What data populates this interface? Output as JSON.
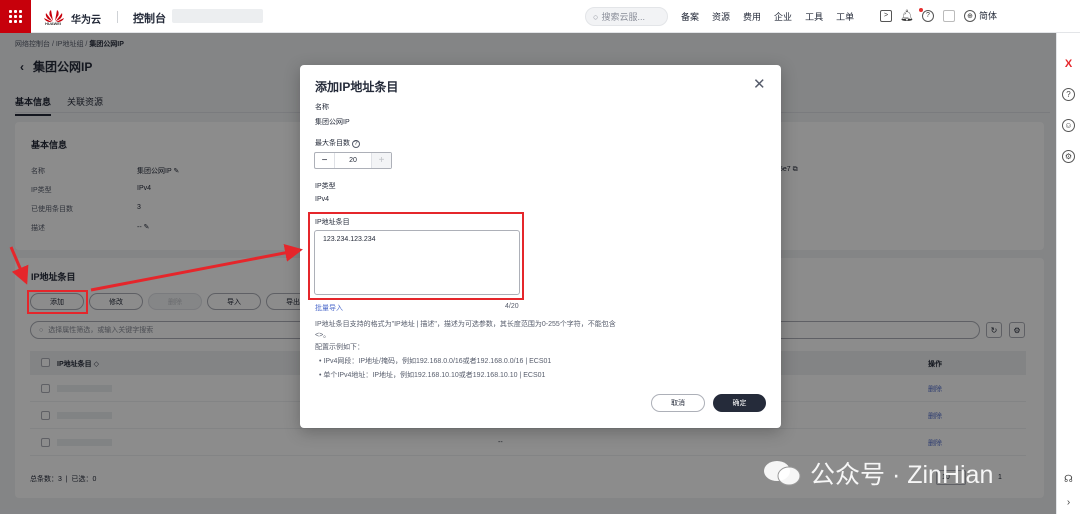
{
  "topbar": {
    "logo_text": "HUAWEI",
    "brand": "华为云",
    "console": "控制台",
    "search_placeholder": "搜索云服...",
    "nav": [
      "备案",
      "资源",
      "费用",
      "企业",
      "工具",
      "工单"
    ],
    "lang": "简体"
  },
  "breadcrumb": {
    "a": "网络控制台",
    "b": "IP地址组",
    "c": "集团公网IP"
  },
  "page_title": "集团公网IP",
  "tabs": [
    "基本信息",
    "关联资源"
  ],
  "basic": {
    "heading": "基本信息",
    "rows": [
      {
        "k": "名称",
        "v": "集团公网IP"
      },
      {
        "k": "IP类型",
        "v": "IPv4"
      },
      {
        "k": "已使用条目数",
        "v": "3"
      },
      {
        "k": "描述",
        "v": "--"
      }
    ],
    "id_tail": "5e7"
  },
  "entries": {
    "heading": "IP地址条目",
    "buttons": [
      "添加",
      "修改",
      "删除",
      "导入",
      "导出"
    ],
    "filter_placeholder": "选择属性筛选，或输入关键字搜索",
    "col_entry": "IP地址条目",
    "col_action": "操作",
    "row_dash": "--",
    "delete": "删除",
    "footer_total": "总条数：3",
    "footer_selected": "已选：0",
    "page_size": "10",
    "page_num": "1"
  },
  "modal": {
    "title": "添加IP地址条目",
    "name_label": "名称",
    "name_value": "集团公网IP",
    "max_label": "最大条目数",
    "max_value": "20",
    "type_label": "IP类型",
    "type_value": "IPv4",
    "entry_label": "IP地址条目",
    "entry_value": "123.234.123.234",
    "batch": "批量导入",
    "counter": "4/20",
    "hint1": "IP地址条目支持的格式为\"IP地址 | 描述\"，描述为可选参数，其长度范围为0-255个字符，不能包含",
    "hint2": "<>。",
    "hint3": "配置示例如下：",
    "hint4": "IPv4网段：IP地址/掩码，例如192.168.0.0/16或者192.168.0.0/16 | ECS01",
    "hint5": "单个IPv4地址：IP地址，例如192.168.10.10或者192.168.10.10 | ECS01",
    "cancel": "取消",
    "ok": "确定"
  },
  "watermark": "公众号 · ZinHian",
  "colors": {
    "brand_red": "#c7000b",
    "annot_red": "#e5262b",
    "primary": "#252b3a",
    "link": "#526ecc"
  }
}
